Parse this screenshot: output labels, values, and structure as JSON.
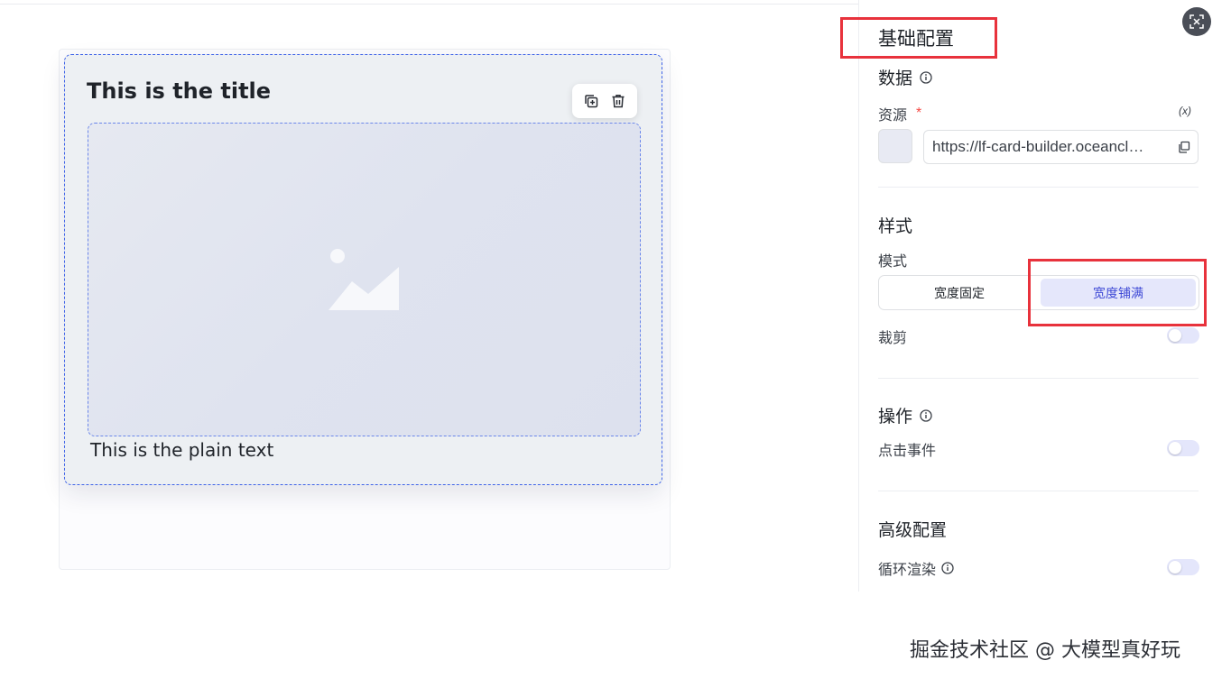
{
  "card": {
    "title": "This is the title",
    "plain_text": "This is the plain text"
  },
  "panel": {
    "title": "基础配置",
    "data_section": "数据",
    "resource_label": "资源",
    "required_mark": "*",
    "fx_label": "(x)",
    "resource_url": "https://lf-card-builder.oceancl…",
    "style_section": "样式",
    "mode_label": "模式",
    "mode_options": [
      "宽度固定",
      "宽度铺满"
    ],
    "mode_selected": "宽度铺满",
    "crop_label": "裁剪",
    "crop_enabled": false,
    "action_section": "操作",
    "click_event_label": "点击事件",
    "click_event_enabled": false,
    "advanced_section": "高级配置",
    "loop_render_label": "循环渲染",
    "loop_render_enabled": false
  },
  "icons": {
    "toolbar": [
      "copy-icon",
      "delete-icon"
    ],
    "panel": [
      "collapse-icon",
      "info-icon",
      "copy-icon"
    ],
    "image": "image-placeholder-icon"
  },
  "colors": {
    "accent": "#3f4ad6",
    "selection_border": "#3f63e8",
    "highlight_box": "#e8323c"
  },
  "watermark": "掘金技术社区 @ 大模型真好玩"
}
